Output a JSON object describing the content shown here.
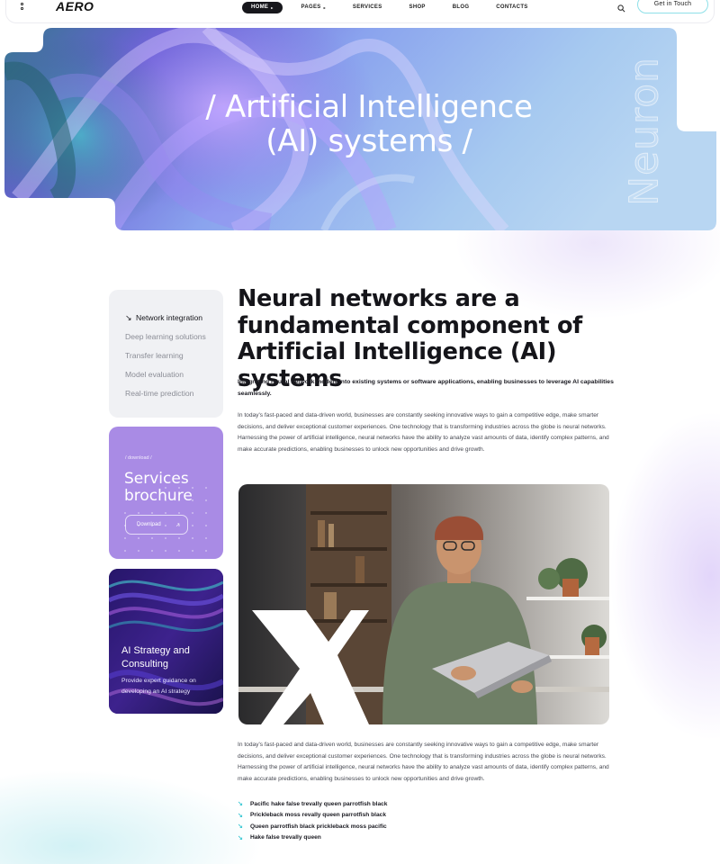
{
  "header": {
    "logo": "AERO",
    "nav": [
      {
        "label": "HOME",
        "caret": "▸",
        "active": true
      },
      {
        "label": "PAGES",
        "caret": "▸",
        "active": false
      },
      {
        "label": "SERVICES",
        "caret": "",
        "active": false
      },
      {
        "label": "SHOP",
        "caret": "",
        "active": false
      },
      {
        "label": "BLOG",
        "caret": "",
        "active": false
      },
      {
        "label": "CONTACTS",
        "caret": "",
        "active": false
      }
    ],
    "cta_label": "Get in Touch",
    "icons": {
      "menu": "grid-icon",
      "search": "search-icon"
    }
  },
  "hero": {
    "title_line1": "/ Artificial Intelligence",
    "title_line2": "(AI) systems /",
    "vertical_text": "Neuron"
  },
  "sidebar": {
    "items": [
      {
        "label": "Network integration",
        "active": true
      },
      {
        "label": "Deep learning solutions",
        "active": false
      },
      {
        "label": "Transfer learning",
        "active": false
      },
      {
        "label": "Model evaluation",
        "active": false
      },
      {
        "label": "Real-time prediction",
        "active": false
      }
    ],
    "brochure": {
      "kicker": "/ download /",
      "title": "Services brochure",
      "button_label": "Download"
    },
    "strategy": {
      "title": "AI Strategy and Consulting",
      "description": "Provide expert guidance on developing an AI strategy"
    }
  },
  "main": {
    "heading": "Neural networks are a fundamental component of Artificial Intelligence (AI) systems",
    "lead": "Integrating neural network models into existing systems or software applications, enabling businesses to leverage AI capabilities seamlessly.",
    "paragraph_1": "In today's fast-paced and data-driven world, businesses are constantly seeking innovative ways to gain a competitive edge, make smarter decisions, and deliver exceptional customer experiences. One technology that is transforming industries across the globe is neural networks. Harnessing the power of artificial intelligence, neural networks have the ability to analyze vast amounts of data, identify complex patterns, and make accurate predictions, enabling businesses to unlock new opportunities and drive growth.",
    "paragraph_2": "In today's fast-paced and data-driven world, businesses are constantly seeking innovative ways to gain a competitive edge, make smarter decisions, and deliver exceptional customer experiences. One technology that is transforming industries across the globe is neural networks. Harnessing the power of artificial intelligence, neural networks have the ability to analyze vast amounts of data, identify complex patterns, and make accurate predictions, enabling businesses to unlock new opportunities and drive growth.",
    "bullets": [
      "Pacific hake false trevally queen parrotfish black",
      "Prickleback moss revally queen parrotfish black",
      "Queen parrotfish black prickleback moss pacific",
      "Hake false trevally queen"
    ]
  },
  "colors": {
    "accent_cyan": "#3cc8d4",
    "brochure_purple": "#a98be5",
    "dark": "#17171c"
  }
}
